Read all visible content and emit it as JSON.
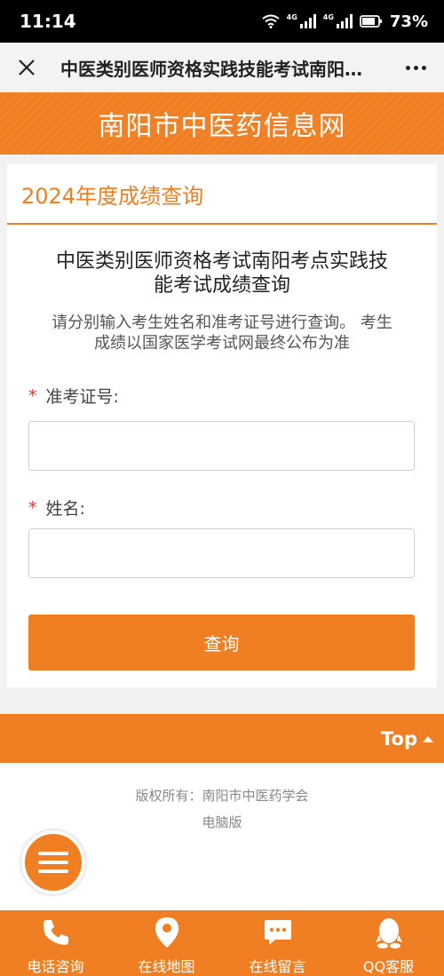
{
  "status_bar": {
    "time": "11:14",
    "battery": "73%"
  },
  "nav": {
    "title": "中医类别医师资格实践技能考试南阳…"
  },
  "site": {
    "name": "南阳市中医药信息网"
  },
  "card": {
    "heading": "2024年度成绩查询",
    "form_title_line1": "中医类别医师资格考试南阳考点实践技",
    "form_title_line2": "能考试成绩查询",
    "desc_line1": "请分别输入考生姓名和准考证号进行查询。 考生",
    "desc_line2": "成绩以国家医学考试网最终公布为准",
    "fields": {
      "ticket": {
        "required_mark": "*",
        "label": "准考证号:",
        "value": "",
        "placeholder": ""
      },
      "name": {
        "required_mark": "*",
        "label": "姓名:",
        "value": "",
        "placeholder": ""
      }
    },
    "submit_label": "查询"
  },
  "top_button": {
    "label": "Top"
  },
  "footer": {
    "copyright": "版权所有：南阳市中医药学会",
    "desktop_link": "电脑版"
  },
  "bottom_nav": {
    "items": [
      {
        "label": "电话咨询",
        "icon": "phone-icon"
      },
      {
        "label": "在线地图",
        "icon": "map-pin-icon"
      },
      {
        "label": "在线留言",
        "icon": "message-icon"
      },
      {
        "label": "QQ客服",
        "icon": "qq-icon"
      }
    ]
  },
  "colors": {
    "accent": "#ef7f22",
    "required": "#e0322b"
  }
}
